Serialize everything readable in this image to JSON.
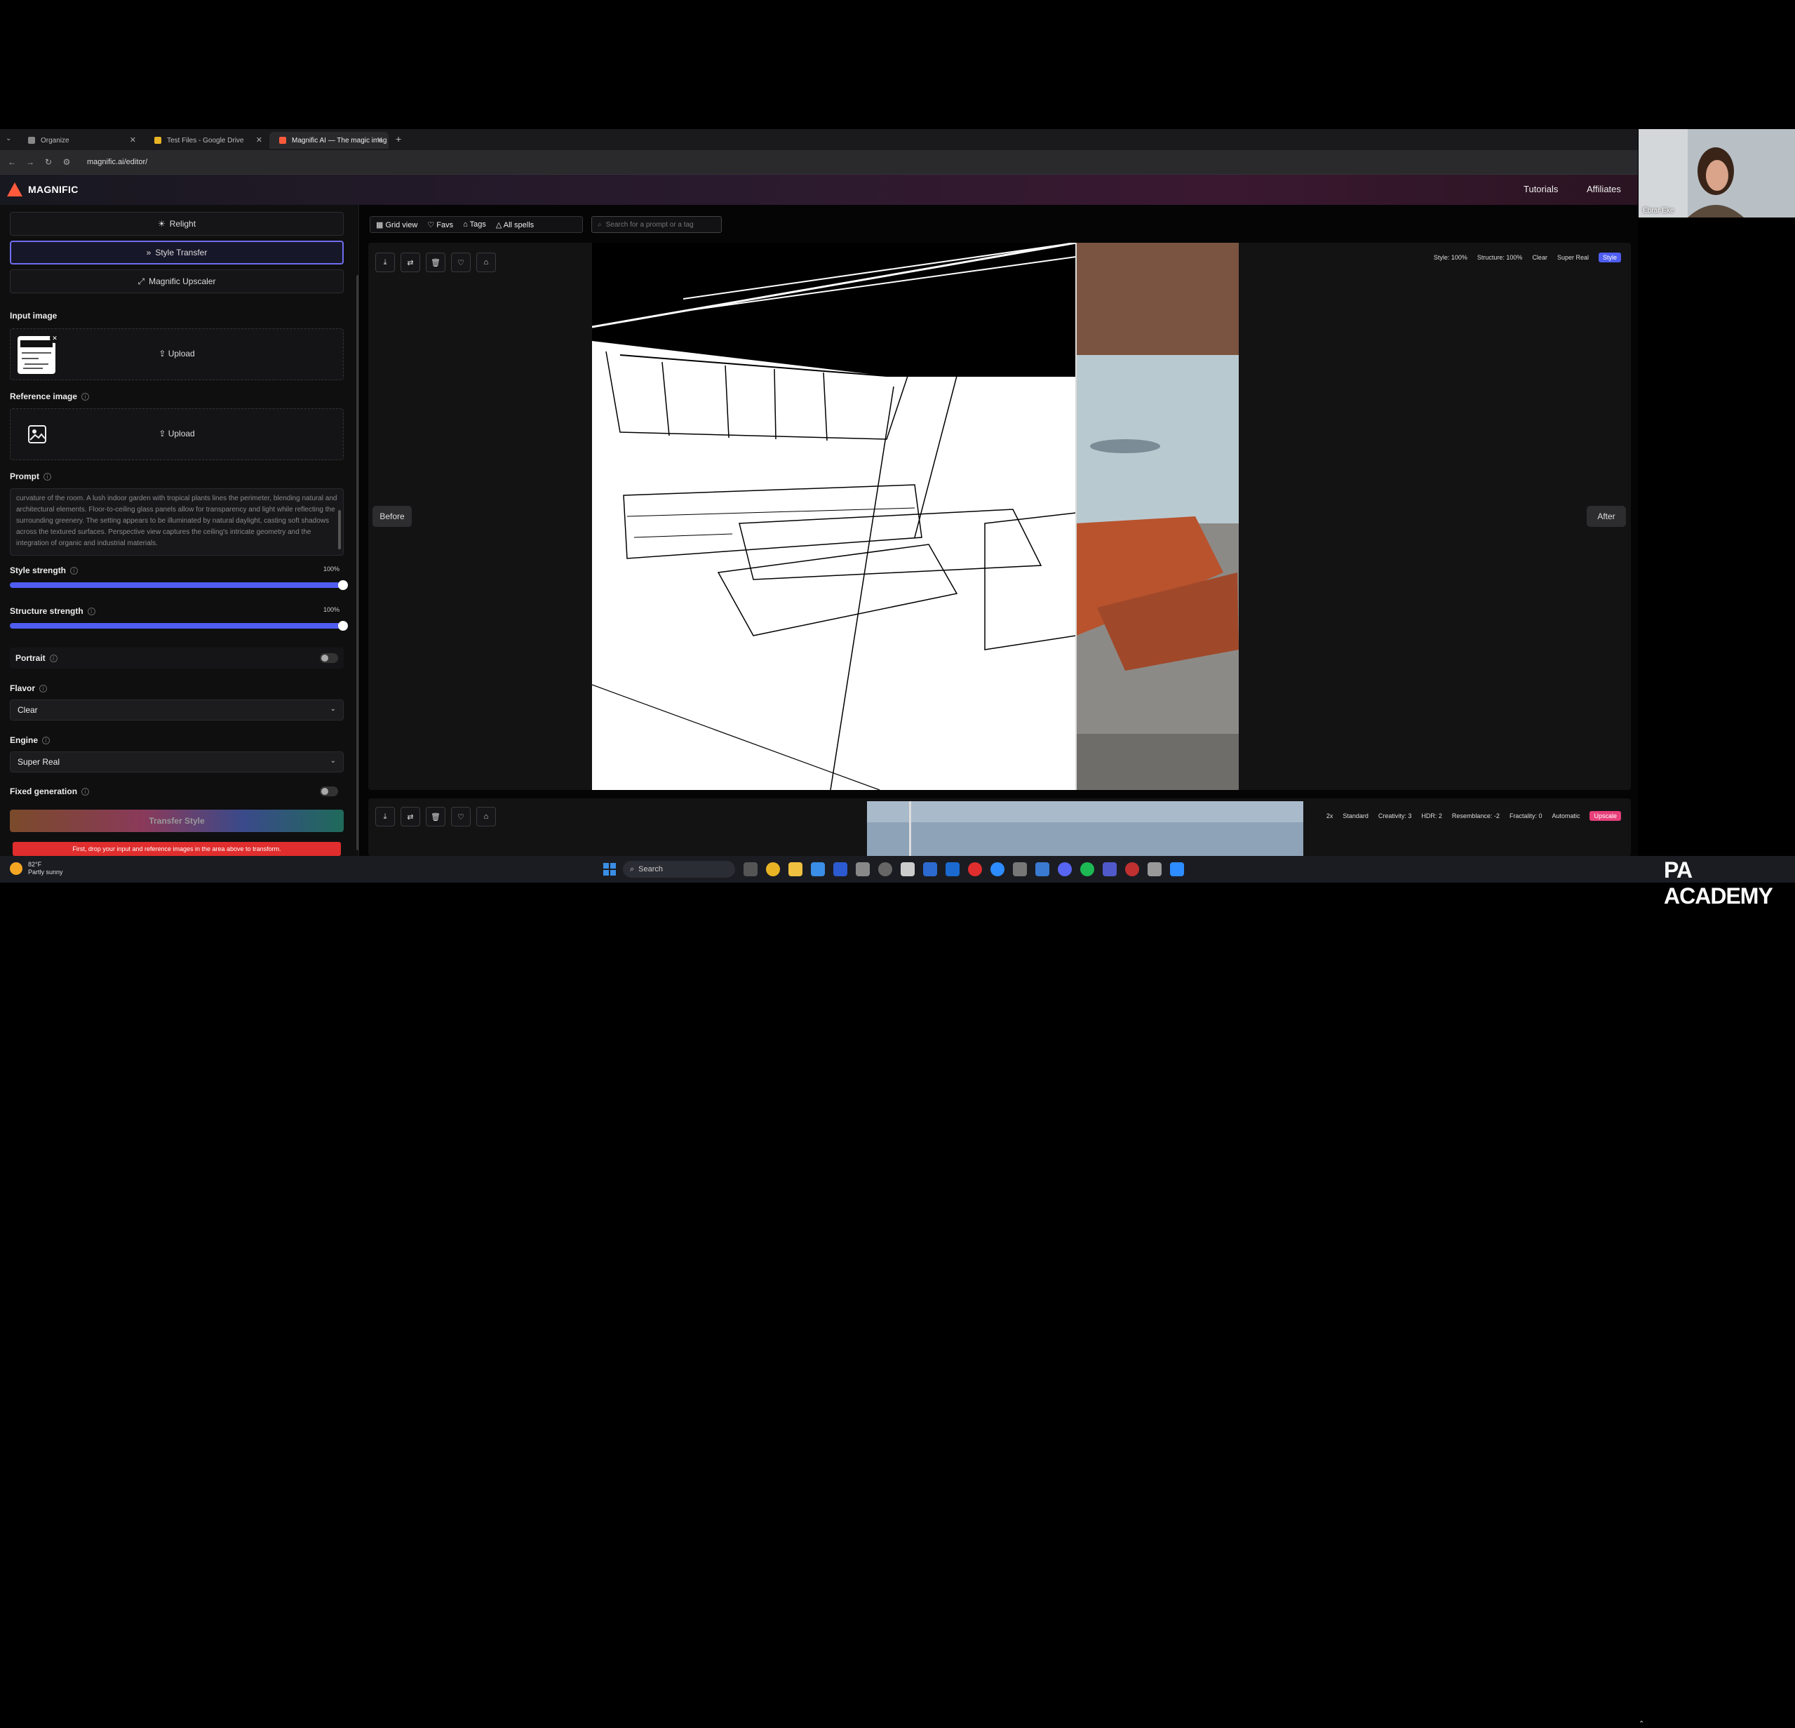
{
  "browser": {
    "tabs": [
      {
        "title": "Organize",
        "active": false
      },
      {
        "title": "Test Files - Google Drive",
        "active": false
      },
      {
        "title": "Magnific AI — The magic imag",
        "active": true
      }
    ],
    "new_tab": "+",
    "url": "magnific.ai/editor/"
  },
  "header": {
    "brand": "MAGNIFIC",
    "links": [
      "Tutorials",
      "Affiliates"
    ]
  },
  "webcam": {
    "name": "Ebrar Eke"
  },
  "sidebar": {
    "modes": [
      {
        "label": "Relight",
        "icon": "☀",
        "selected": false
      },
      {
        "label": "Style Transfer",
        "icon": "»",
        "selected": true
      },
      {
        "label": "Magnific Upscaler",
        "icon": "⤢",
        "selected": false
      }
    ],
    "input_image": {
      "label": "Input image",
      "upload": "Upload"
    },
    "reference_image": {
      "label": "Reference image",
      "upload": "Upload"
    },
    "prompt": {
      "label": "Prompt",
      "text": "curvature of the room. A lush indoor garden with tropical plants lines the perimeter, blending natural and architectural elements. Floor-to-ceiling glass panels allow for transparency and light while reflecting the surrounding greenery. The setting appears to be illuminated by natural daylight, casting soft shadows across the textured surfaces. Perspective view captures the ceiling's intricate geometry and the integration of organic and industrial materials."
    },
    "style_strength": {
      "label": "Style strength",
      "value": "100%",
      "level": 1.0
    },
    "structure_strength": {
      "label": "Structure strength",
      "value": "100%",
      "level": 1.0
    },
    "portrait": {
      "label": "Portrait",
      "on": false
    },
    "flavor": {
      "label": "Flavor",
      "value": "Clear"
    },
    "engine": {
      "label": "Engine",
      "value": "Super Real"
    },
    "fixed_generation": {
      "label": "Fixed generation",
      "on": false
    },
    "submit": "Transfer Style",
    "error": "First, drop your input and reference images in the area above to transform."
  },
  "main": {
    "toolbar": {
      "grid_view": "Grid view",
      "favs": "Favs",
      "tags": "Tags",
      "all_spells": "All spells"
    },
    "search_placeholder": "Search for a prompt or a tag",
    "result1": {
      "before": "Before",
      "after": "After",
      "meta": [
        "Style: 100%",
        "Structure: 100%",
        "Clear",
        "Super Real"
      ],
      "chip": "Style"
    },
    "result2": {
      "meta": [
        "2x",
        "Standard",
        "Creativity: 3",
        "HDR: 2",
        "Resemblance: -2",
        "Fractality: 0",
        "Automatic"
      ],
      "chip": "Upscale"
    }
  },
  "taskbar": {
    "weather_temp": "82°F",
    "weather_desc": "Partly sunny",
    "search": "Search",
    "watermark": "PA ACADEMY"
  },
  "colors": {
    "accent": "#4f5df0",
    "error": "#e02d2d",
    "brand": "#ff5a3c",
    "upscale_chip": "#e8407a"
  }
}
